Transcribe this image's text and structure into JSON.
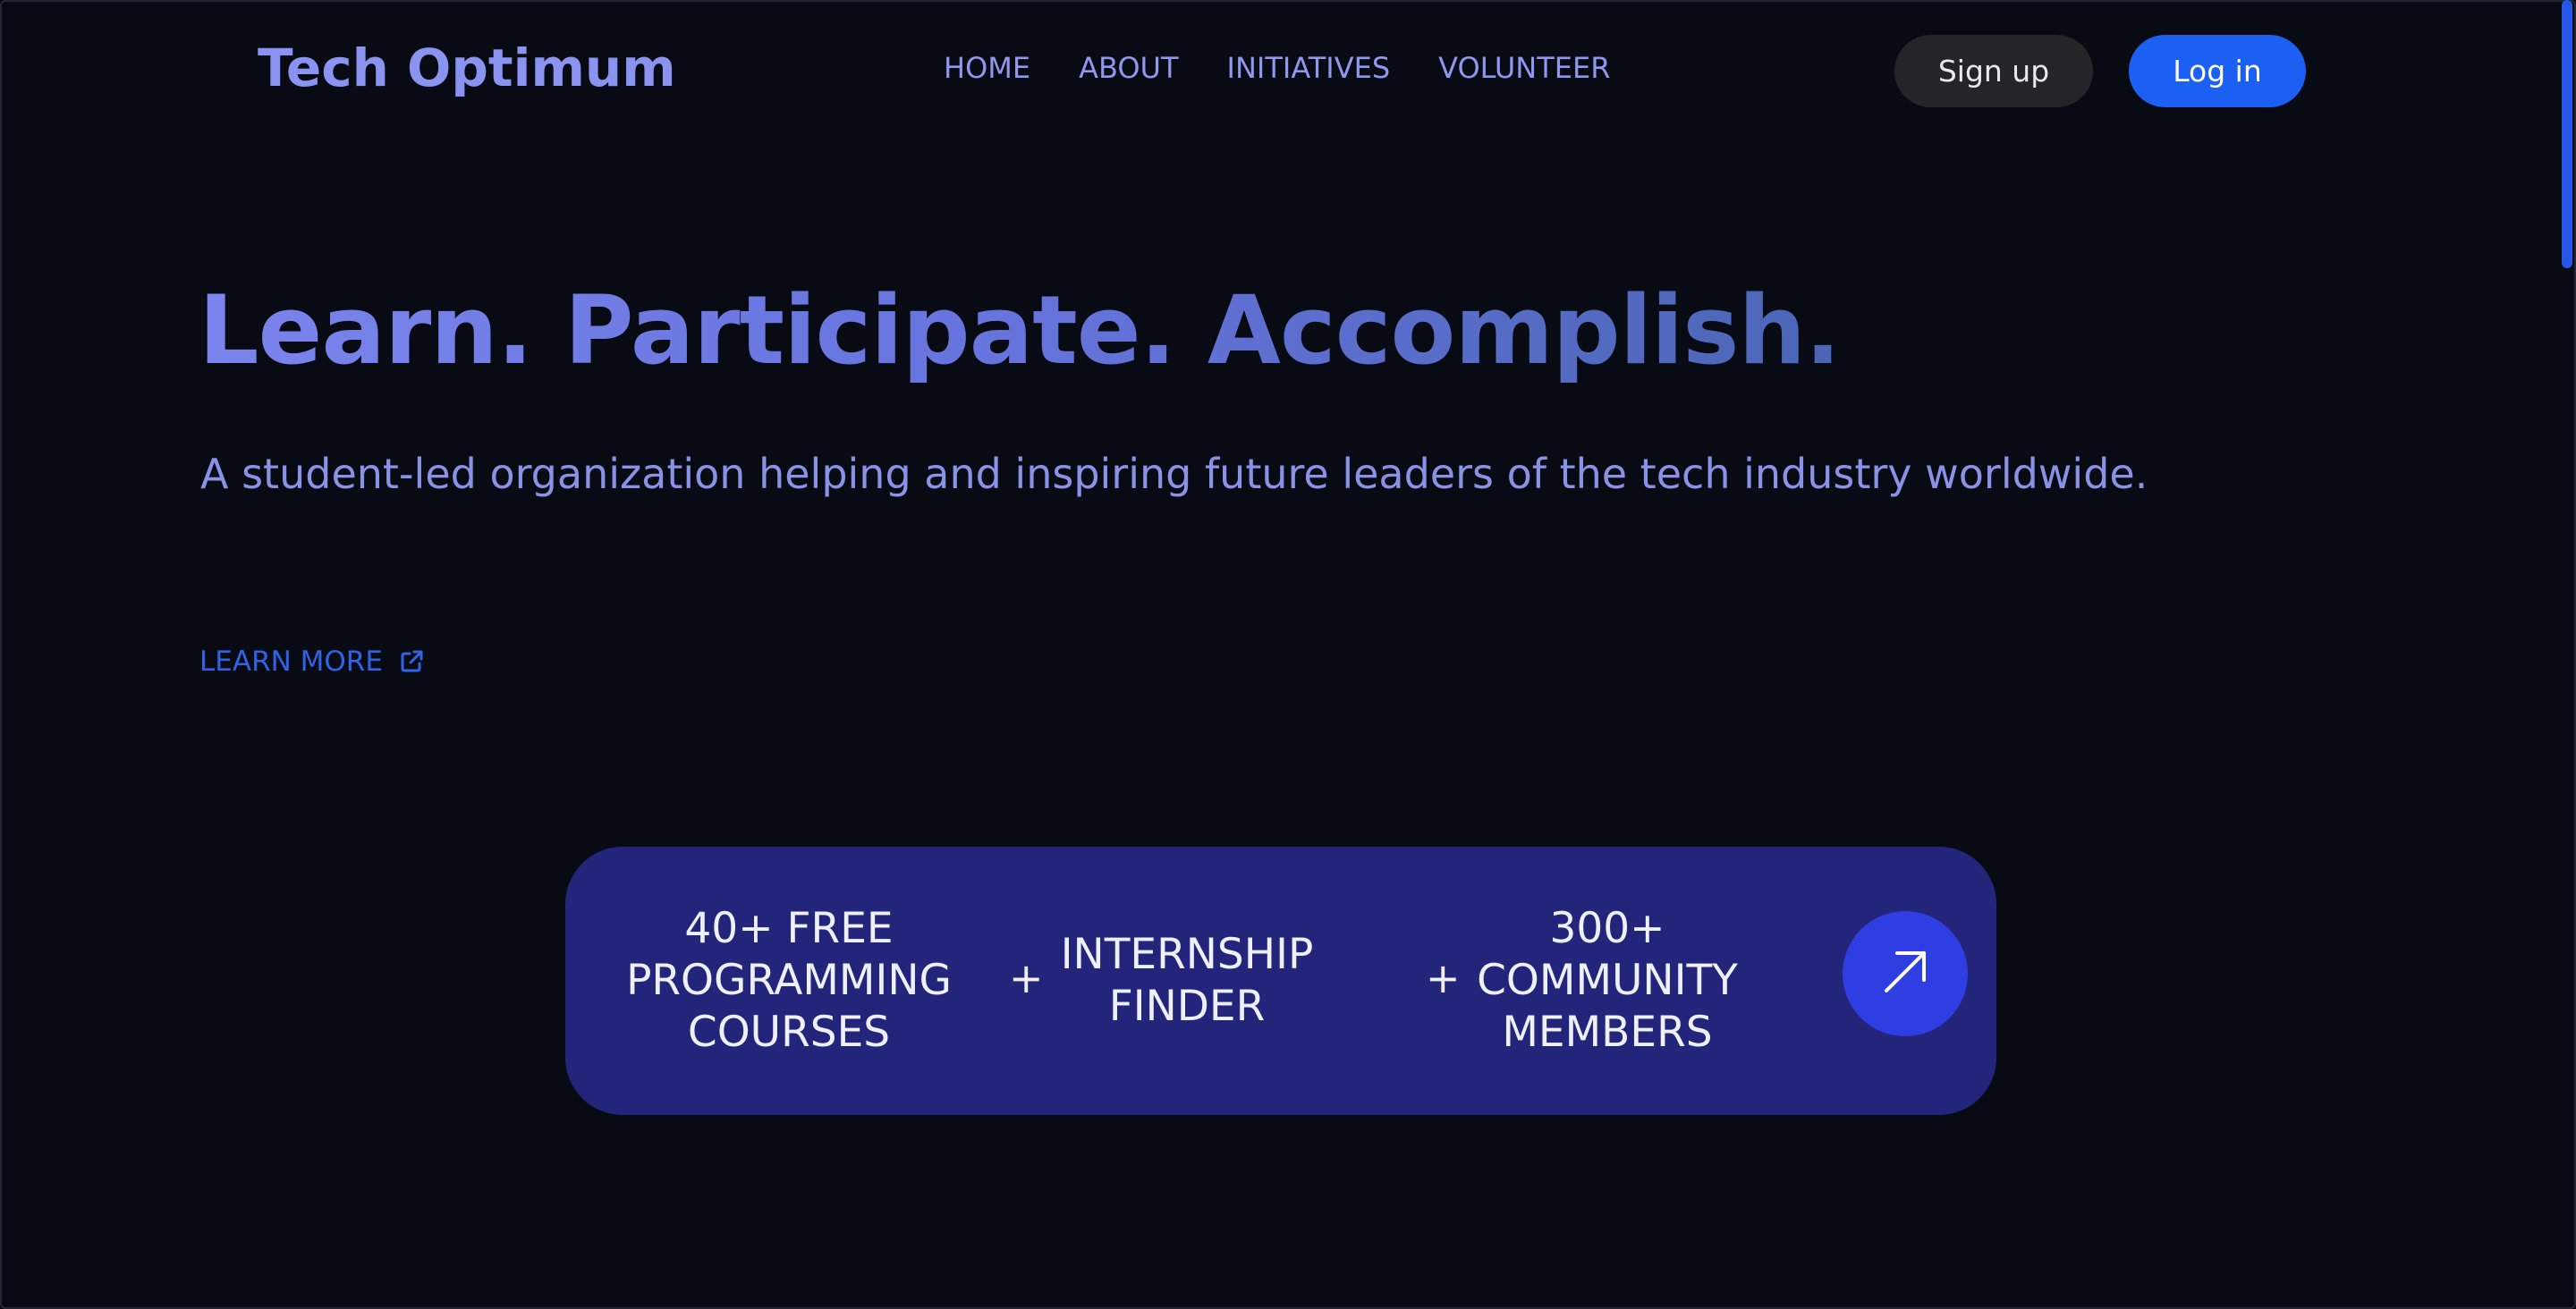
{
  "header": {
    "logo": "Tech Optimum",
    "nav": [
      {
        "label": "HOME"
      },
      {
        "label": "ABOUT"
      },
      {
        "label": "INITIATIVES"
      },
      {
        "label": "VOLUNTEER"
      }
    ],
    "signup_label": "Sign up",
    "login_label": "Log in"
  },
  "hero": {
    "headline": "Learn. Participate. Accomplish.",
    "subtitle": "A student-led organization helping and inspiring future leaders of the tech industry worldwide.",
    "learn_more": "LEARN MORE",
    "learn_more_icon": "external-link-icon"
  },
  "features": {
    "items": [
      {
        "label": "40+ FREE PROGRAMMING COURSES"
      },
      {
        "label": "INTERNSHIP FINDER"
      },
      {
        "label": "300+ COMMUNITY MEMBERS"
      }
    ],
    "separator": "+",
    "arrow_icon": "arrow-up-right-icon"
  },
  "colors": {
    "background": "#080b14",
    "brand": "#8a93f0",
    "accent": "#1b60f2",
    "pill": "#222579",
    "arrow_circle": "#2f3ee2"
  }
}
